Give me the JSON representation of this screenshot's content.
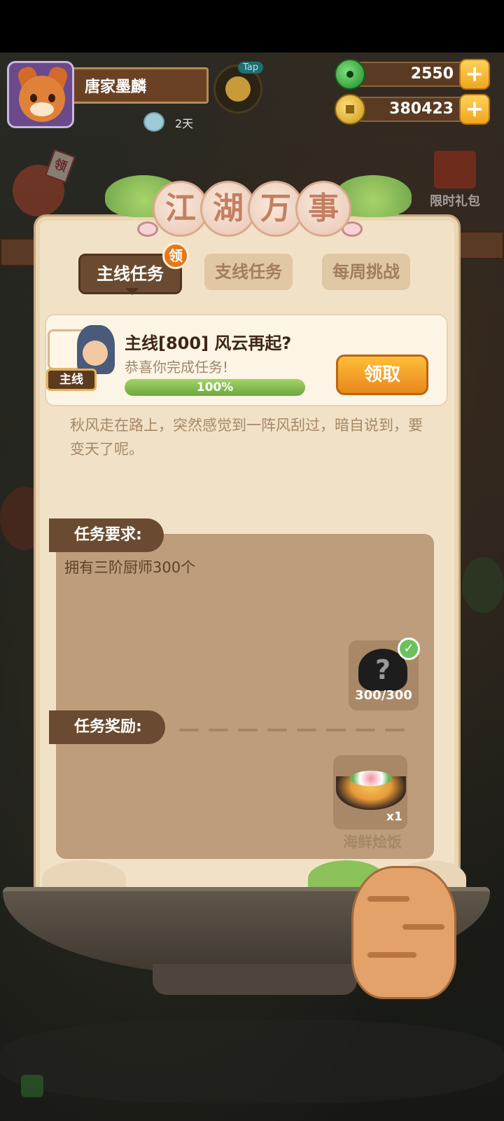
{
  "header": {
    "player_name": "唐家墨麟",
    "days_label": "2天",
    "tap_label": "Tap",
    "jade_amount": "2550",
    "coin_amount": "380423",
    "plus_symbol": "+"
  },
  "side_decorations": {
    "gift_label": "限时礼包",
    "left_tag": "领"
  },
  "panel": {
    "title_chars": [
      "江",
      "湖",
      "万",
      "事"
    ],
    "tabs": [
      {
        "label": "主线任务",
        "active": true
      },
      {
        "label": "支线任务",
        "active": false
      },
      {
        "label": "每周挑战",
        "active": false
      }
    ],
    "tab_badge": "领"
  },
  "task": {
    "tag": "主线",
    "title": "主线[800] 风云再起?",
    "subtitle": "恭喜你完成任务!",
    "progress_text": "100%",
    "progress_fraction": 1.0,
    "claim_label": "领取",
    "description": "秋风走在路上，突然感觉到一阵风刮过，暗自说到，要变天了呢。"
  },
  "requirement": {
    "heading": "任务要求:",
    "text": "拥有三阶厨师300个",
    "icon_symbol": "?",
    "check_symbol": "✓",
    "count": "300/300"
  },
  "reward": {
    "heading": "任务奖励:",
    "item_name": "海鲜烩饭",
    "quantity": "x1"
  },
  "colors": {
    "panel_bg": "#f1e2c7",
    "accent_brown": "#6a4b31",
    "progress_green": "#6fa640",
    "claim_orange": "#e8871c"
  }
}
